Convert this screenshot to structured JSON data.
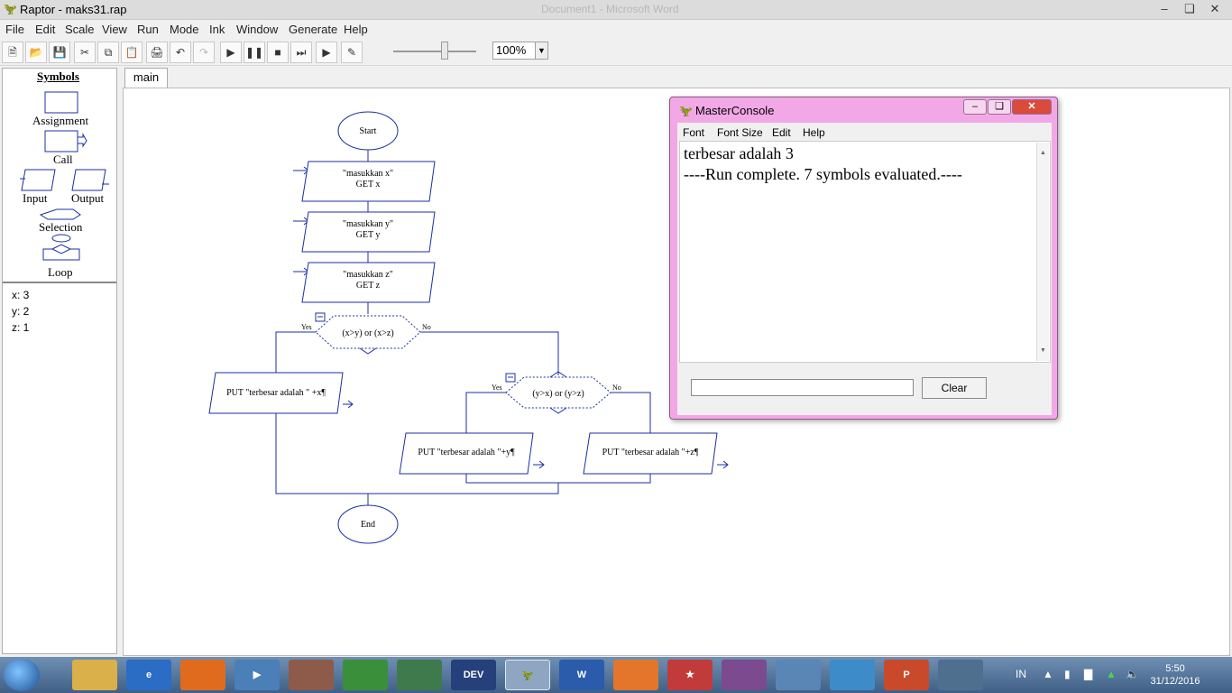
{
  "window": {
    "title": "Raptor - maks31.rap",
    "background_title": "Document1 - Microsoft Word"
  },
  "menu": [
    "File",
    "Edit",
    "Scale",
    "View",
    "Run",
    "Mode",
    "Ink",
    "Window",
    "Generate",
    "Help"
  ],
  "toolbar": {
    "zoom": "100%"
  },
  "symbols": {
    "title": "Symbols",
    "items": [
      "Assignment",
      "Call",
      "Input",
      "Output",
      "Selection",
      "Loop"
    ]
  },
  "variables": [
    "x: 3",
    "y: 2",
    "z: 1"
  ],
  "tab": "main",
  "flowchart": {
    "start": "Start",
    "end": "End",
    "inputs": [
      {
        "prompt": "\"masukkan x\"",
        "get": "GET x"
      },
      {
        "prompt": "\"masukkan y\"",
        "get": "GET y"
      },
      {
        "prompt": "\"masukkan z\"",
        "get": "GET z"
      }
    ],
    "selection1": {
      "condition": "(x>y) or (x>z)",
      "yes": "Yes",
      "no": "No"
    },
    "selection2": {
      "condition": "(y>x) or (y>z)",
      "yes": "Yes",
      "no": "No"
    },
    "outputs": [
      "PUT \"terbesar adalah \" +x¶",
      "PUT \"terbesar adalah \"+y¶",
      "PUT \"terbesar adalah \"+z¶"
    ]
  },
  "console": {
    "title": "MasterConsole",
    "menu": [
      "Font",
      "Font Size",
      "Edit",
      "Help"
    ],
    "lines": [
      "terbesar adalah 3",
      "----Run complete.  7 symbols evaluated.----"
    ],
    "clear_label": "Clear"
  },
  "taskbar": {
    "lang": "IN",
    "time": "5:50",
    "date": "31/12/2016"
  }
}
